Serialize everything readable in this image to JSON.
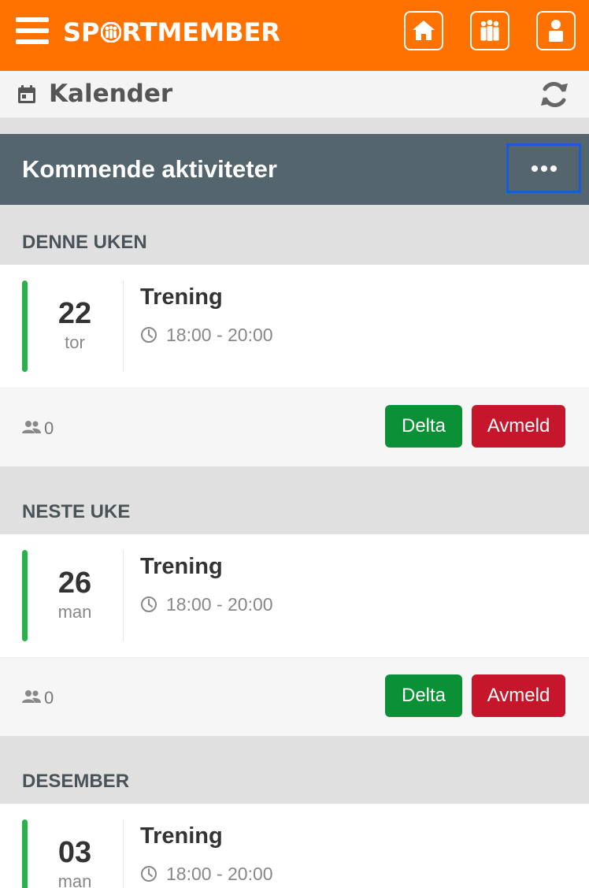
{
  "app": {
    "brand_prefix": "SP",
    "brand_suffix": "RTMEMBER",
    "nav": [
      {
        "name": "home-icon"
      },
      {
        "name": "group-icon"
      },
      {
        "name": "user-icon"
      }
    ],
    "accent": "#ff7200"
  },
  "subheader": {
    "title": "Kalender"
  },
  "section": {
    "title": "Kommende aktiviteter"
  },
  "groups": [
    {
      "label": "DENNE UKEN",
      "event": {
        "day": "22",
        "weekday": "tor",
        "title": "Trening",
        "time": "18:00 - 20:00",
        "participants": "0",
        "join_label": "Delta",
        "decline_label": "Avmeld"
      }
    },
    {
      "label": "NESTE UKE",
      "event": {
        "day": "26",
        "weekday": "man",
        "title": "Trening",
        "time": "18:00 - 20:00",
        "participants": "0",
        "join_label": "Delta",
        "decline_label": "Avmeld"
      }
    },
    {
      "label": "DESEMBER",
      "event": {
        "day": "03",
        "weekday": "man",
        "title": "Trening",
        "time": "18:00 - 20:00"
      }
    }
  ],
  "colors": {
    "status_bar": "#2ab14b",
    "delta_button": "#0a9136",
    "avmeld_button": "#c6162b",
    "section_header": "#55656d"
  }
}
